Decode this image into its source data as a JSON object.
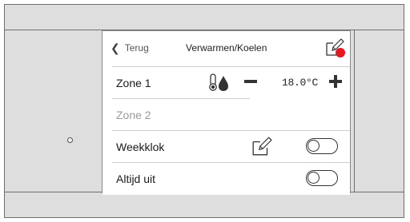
{
  "header": {
    "back_label": "Terug",
    "title": "Verwarmen/Koelen",
    "edit_icon": "edit-note-icon",
    "notification_color": "#e8141e"
  },
  "zones": [
    {
      "label": "Zone 1",
      "enabled": true,
      "temperature": "18.0°C",
      "icon": "thermometer-drop-icon"
    },
    {
      "label": "Zone 2",
      "enabled": false
    }
  ],
  "weekklok": {
    "label": "Weekklok",
    "toggle_on": false,
    "edit_icon": "edit-note-icon"
  },
  "altijd_uit": {
    "label": "Altijd uit",
    "toggle_on": false
  },
  "colors": {
    "frame": "#dedede",
    "border": "#6e6e6e",
    "screen": "#ffffff",
    "disabled_text": "#9a9a9a"
  }
}
